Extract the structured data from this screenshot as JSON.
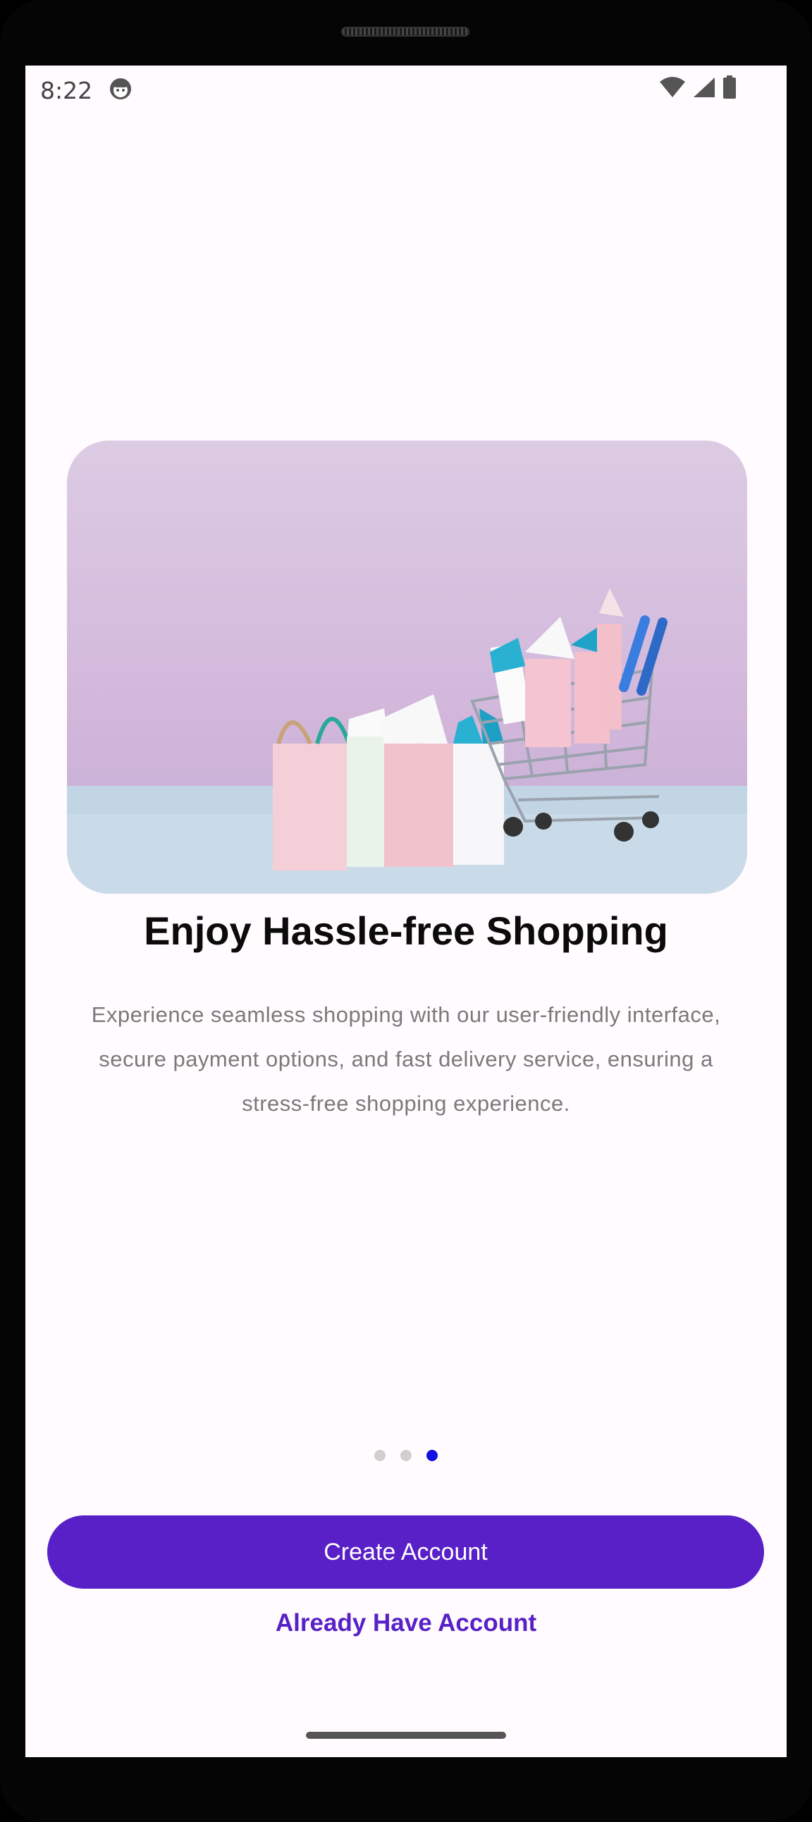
{
  "status_bar": {
    "time": "8:22",
    "app_icon": "android-debug-icon",
    "wifi_icon": "wifi-icon",
    "signal_icon": "cell-signal-icon",
    "battery_icon": "battery-icon"
  },
  "onboarding": {
    "image_alt": "shopping-bags-and-cart",
    "title": "Enjoy Hassle-free Shopping",
    "description": "Experience seamless shopping with our user-friendly interface, secure payment options, and fast delivery service, ensuring a stress-free shopping experience.",
    "page_indicator": {
      "total": 3,
      "current": 3
    }
  },
  "actions": {
    "create_account": "Create Account",
    "already_have_account": "Already Have Account"
  },
  "colors": {
    "primary": "#5820c6",
    "active_dot": "#1010e0",
    "inactive_dot": "#cfcfcf",
    "background": "#fffbfe"
  }
}
